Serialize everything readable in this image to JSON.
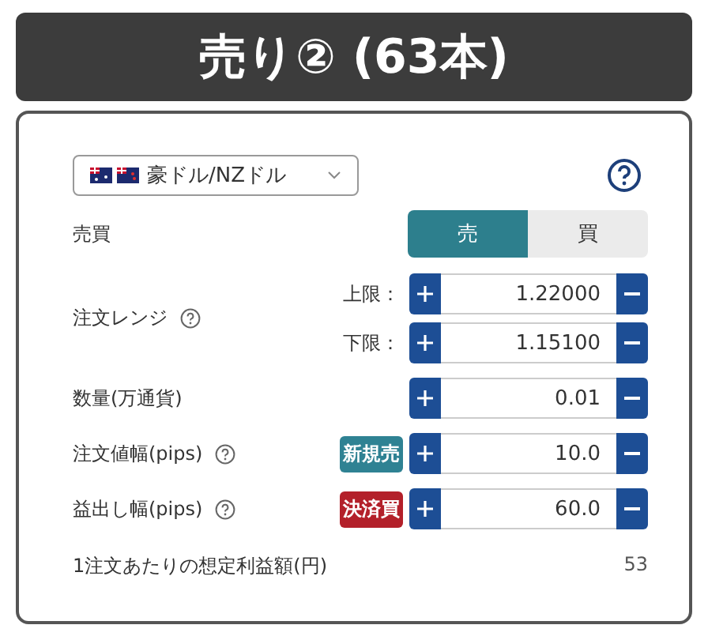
{
  "header": {
    "title": "売り② (63本)"
  },
  "pair": {
    "label": "豪ドル/NZドル"
  },
  "rows": [
    {
      "kind": "side",
      "label": "売買",
      "options": [
        {
          "label": "売",
          "selected": true
        },
        {
          "label": "買",
          "selected": false
        }
      ]
    },
    {
      "kind": "range",
      "label": "注文レンジ",
      "help": true,
      "bounds": [
        {
          "label": "上限：",
          "value": "1.22000"
        },
        {
          "label": "下限：",
          "value": "1.15100"
        }
      ]
    },
    {
      "kind": "stepper",
      "label": "数量(万通貨)",
      "help": false,
      "value": "0.01"
    },
    {
      "kind": "stepper",
      "label": "注文値幅(pips)",
      "help": true,
      "tag": {
        "text": "新規売",
        "color": "#2f8293"
      },
      "value": "10.0"
    },
    {
      "kind": "stepper",
      "label": "益出し幅(pips)",
      "help": true,
      "tag": {
        "text": "決済買",
        "color": "#b3202a"
      },
      "value": "60.0"
    }
  ],
  "summary": {
    "label": "1注文あたりの想定利益額(円)",
    "value": "53"
  }
}
